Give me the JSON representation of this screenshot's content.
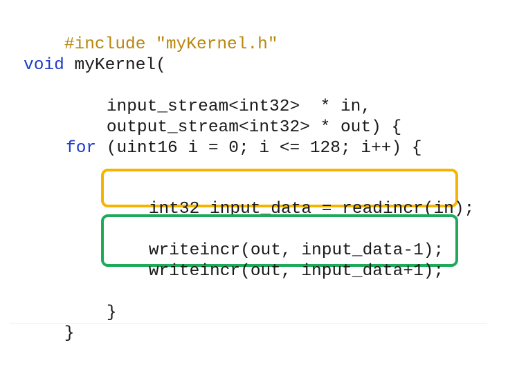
{
  "code": {
    "include_line": "#include \"myKernel.h\"",
    "sig_keyword": "void",
    "sig_name": " myKernel(",
    "param1": "input_stream<int32>  * in,",
    "param2": "output_stream<int32> * out) {",
    "for_keyword": "for",
    "for_rest": " (uint16 i = 0; i <= 128; i++) {",
    "read_line": "int32 input_data = readincr(in);",
    "write_line1": "writeincr(out, input_data-1);",
    "write_line2": "writeincr(out, input_data+1);",
    "inner_close": "}",
    "outer_close": "}"
  },
  "colors": {
    "preprocessor": "#b8860b",
    "keyword": "#1e3cc8",
    "text": "#1a1a1a",
    "highlight_read": "#f5b400",
    "highlight_write": "#1eaa5a"
  }
}
